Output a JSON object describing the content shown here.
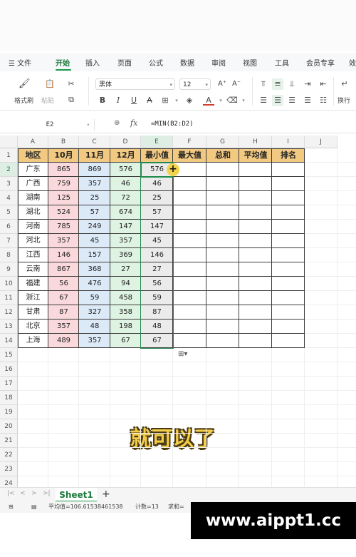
{
  "menubar": {
    "app_menu": "文件",
    "tabs": [
      "开始",
      "插入",
      "页面",
      "公式",
      "数据",
      "审阅",
      "视图",
      "工具",
      "会员专享",
      "效"
    ],
    "active_tab": "开始"
  },
  "toolbar": {
    "format_painter": "格式刷",
    "paste": "粘贴",
    "font_name": "黑体",
    "font_size": "12",
    "bold": "B",
    "italic": "I",
    "underline": "U",
    "strike": "A",
    "font_grow": "A⁺",
    "font_shrink": "A⁻",
    "wrap": "换行"
  },
  "formula_bar": {
    "cell_ref": "E2",
    "fx": "fx",
    "formula": "=MIN(B2:D2)"
  },
  "columns": [
    "A",
    "B",
    "C",
    "D",
    "E",
    "F",
    "G",
    "H",
    "I",
    "J"
  ],
  "rows": [
    "1",
    "2",
    "3",
    "4",
    "5",
    "6",
    "7",
    "8",
    "9",
    "10",
    "11",
    "12",
    "13",
    "14",
    "15",
    "16",
    "17",
    "18",
    "19",
    "20",
    "21",
    "22",
    "23",
    "24"
  ],
  "table": {
    "headers": [
      "地区",
      "10月",
      "11月",
      "12月",
      "最小值",
      "最大值",
      "总和",
      "平均值",
      "排名"
    ],
    "rows": [
      [
        "广东",
        "865",
        "869",
        "576",
        "576"
      ],
      [
        "广西",
        "759",
        "357",
        "46",
        "46"
      ],
      [
        "湖南",
        "125",
        "25",
        "72",
        "25"
      ],
      [
        "湖北",
        "524",
        "57",
        "674",
        "57"
      ],
      [
        "河南",
        "785",
        "249",
        "147",
        "147"
      ],
      [
        "河北",
        "357",
        "45",
        "357",
        "45"
      ],
      [
        "江西",
        "146",
        "157",
        "369",
        "146"
      ],
      [
        "云南",
        "867",
        "368",
        "27",
        "27"
      ],
      [
        "福建",
        "56",
        "476",
        "94",
        "56"
      ],
      [
        "浙江",
        "67",
        "59",
        "458",
        "59"
      ],
      [
        "甘肃",
        "87",
        "327",
        "358",
        "87"
      ],
      [
        "北京",
        "357",
        "48",
        "198",
        "48"
      ],
      [
        "上海",
        "489",
        "357",
        "67",
        "67"
      ]
    ]
  },
  "colors": {
    "header_fill": "#f2c981",
    "oct_fill": "#f9d9dc",
    "nov_fill": "#dce9f7",
    "dec_fill": "#dff3e2",
    "min_fill": "#ebebeb",
    "accent": "#1a7a3c"
  },
  "caption": "就可以了",
  "sheet_tabs": {
    "active": "Sheet1",
    "add": "+"
  },
  "status": {
    "average": "平均值=106.61538461538",
    "count": "计数=13",
    "sum": "求和="
  },
  "watermark": "www.aippt1.cc"
}
